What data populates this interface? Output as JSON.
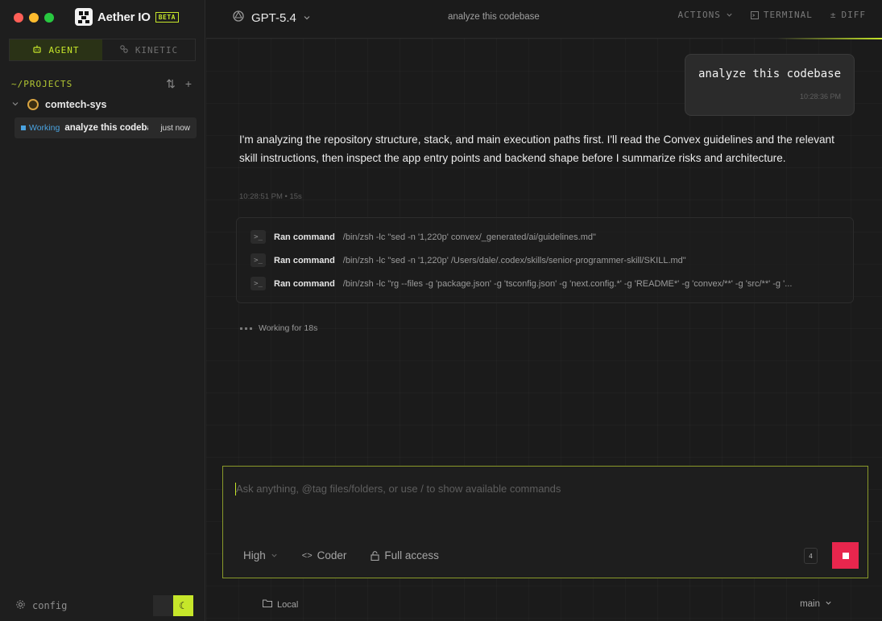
{
  "window": {
    "traffic_colors": [
      "#ff5f57",
      "#febc2e",
      "#28c840"
    ]
  },
  "brand": {
    "name": "Aether IO",
    "badge": "BETA",
    "accent": "#c6e62a"
  },
  "sidebar": {
    "modes": [
      {
        "label": "AGENT",
        "icon": "robot-icon",
        "active": true
      },
      {
        "label": "KINETIC",
        "icon": "link-icon",
        "active": false
      }
    ],
    "projects_label": "~/PROJECTS",
    "project": {
      "name": "comtech-sys",
      "icon": "project-avatar-icon"
    },
    "thread": {
      "status": "Working",
      "title": "analyze this codebase",
      "time": "just now",
      "status_color": "#4aa3e0"
    },
    "config_label": "config"
  },
  "topbar": {
    "model": "GPT-5.4",
    "title": "analyze this codebase",
    "actions": [
      {
        "label": "ACTIONS",
        "icon": "chevron-down-icon"
      },
      {
        "label": "TERMINAL",
        "icon": "terminal-icon"
      },
      {
        "label": "DIFF",
        "icon": "plus-minus-icon"
      }
    ]
  },
  "conversation": {
    "user_message": {
      "text": "analyze this codebase",
      "time": "10:28:36 PM"
    },
    "assistant_message": {
      "text": "I'm analyzing the repository structure, stack, and main execution paths first. I'll read the Convex guidelines and the relevant skill instructions, then inspect the app entry points and backend shape before I summarize risks and architecture.",
      "meta": "10:28:51 PM • 15s"
    },
    "commands": [
      {
        "label": "Ran command",
        "text": "/bin/zsh -lc \"sed -n '1,220p' convex/_generated/ai/guidelines.md\""
      },
      {
        "label": "Ran command",
        "text": "/bin/zsh -lc \"sed -n '1,220p' /Users/dale/.codex/skills/senior-programmer-skill/SKILL.md\""
      },
      {
        "label": "Ran command",
        "text": "/bin/zsh -lc \"rg --files -g 'package.json' -g 'tsconfig.json' -g 'next.config.*' -g 'README*' -g 'convex/**' -g 'src/**' -g '..."
      }
    ],
    "working_status": "Working for 18s"
  },
  "composer": {
    "placeholder": "Ask anything, @tag files/folders, or use / to show available commands",
    "effort": "High",
    "mode": "Coder",
    "access": "Full access",
    "queue_count": "4",
    "stop_color": "#e8264d"
  },
  "footer": {
    "location": "Local",
    "branch": "main"
  }
}
